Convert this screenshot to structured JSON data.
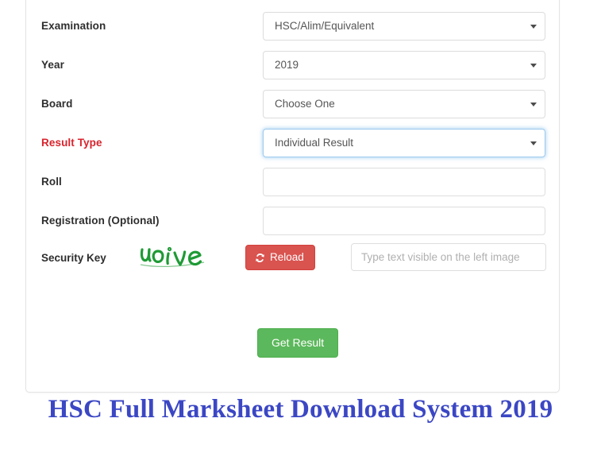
{
  "form": {
    "fields": [
      {
        "key": "examination",
        "label": "Examination",
        "type": "select",
        "value": "HSC/Alim/Equivalent",
        "highlight": false,
        "focused": false
      },
      {
        "key": "year",
        "label": "Year",
        "type": "select",
        "value": "2019",
        "highlight": false,
        "focused": false
      },
      {
        "key": "board",
        "label": "Board",
        "type": "select",
        "value": "Choose One",
        "highlight": false,
        "focused": false
      },
      {
        "key": "result-type",
        "label": "Result Type",
        "type": "select",
        "value": "Individual Result",
        "highlight": true,
        "focused": true
      },
      {
        "key": "roll",
        "label": "Roll",
        "type": "text",
        "value": "",
        "placeholder": "",
        "highlight": false,
        "focused": false
      },
      {
        "key": "registration",
        "label": "Registration (Optional)",
        "type": "text",
        "value": "",
        "placeholder": "",
        "highlight": false,
        "focused": false
      }
    ],
    "security": {
      "label": "Security Key",
      "captcha_text": "uoive",
      "captcha_color": "#1f9a35",
      "reload_label": "Reload",
      "reload_icon": "refresh-icon",
      "reload_color": "#d9534f",
      "input_value": "",
      "input_placeholder": "Type text visible on the left image"
    },
    "submit": {
      "label": "Get Result",
      "color": "#5cb85c"
    }
  },
  "heading": {
    "text": "HSC Full Marksheet Download System 2019",
    "color": "#3b47c4"
  },
  "icons": {
    "dropdown": "chevron-down-icon"
  }
}
